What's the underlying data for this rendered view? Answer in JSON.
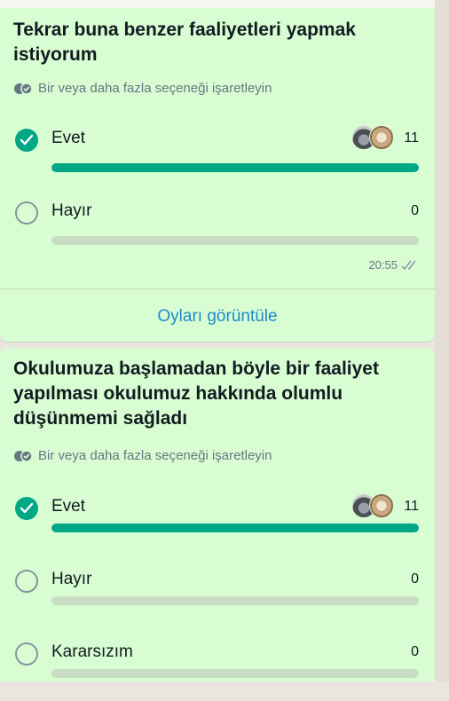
{
  "colors": {
    "accent": "#00a884",
    "bubble": "#d9fdd3",
    "link": "#1e8bc7"
  },
  "polls": [
    {
      "question": "Tekrar buna benzer faaliyetleri yapmak istiyorum",
      "hint": "Bir veya daha fazla seçeneği işaretleyin",
      "options": [
        {
          "label": "Evet",
          "count": "11",
          "selected": true,
          "fraction": 1.0
        },
        {
          "label": "Hayır",
          "count": "0",
          "selected": false,
          "fraction": 0
        }
      ],
      "time": "20:55",
      "status_icon": "double-check-icon",
      "view_votes": "Oyları görüntüle"
    },
    {
      "question": "Okulumuza başlamadan böyle bir faaliyet yapılması okulumuz hakkında olumlu düşünmemi sağladı",
      "hint": "Bir veya daha fazla seçeneği işaretleyin",
      "options": [
        {
          "label": "Evet",
          "count": "11",
          "selected": true,
          "fraction": 1.0
        },
        {
          "label": "Hayır",
          "count": "0",
          "selected": false,
          "fraction": 0
        },
        {
          "label": "Kararsızım",
          "count": "0",
          "selected": false,
          "fraction": 0
        }
      ]
    }
  ]
}
